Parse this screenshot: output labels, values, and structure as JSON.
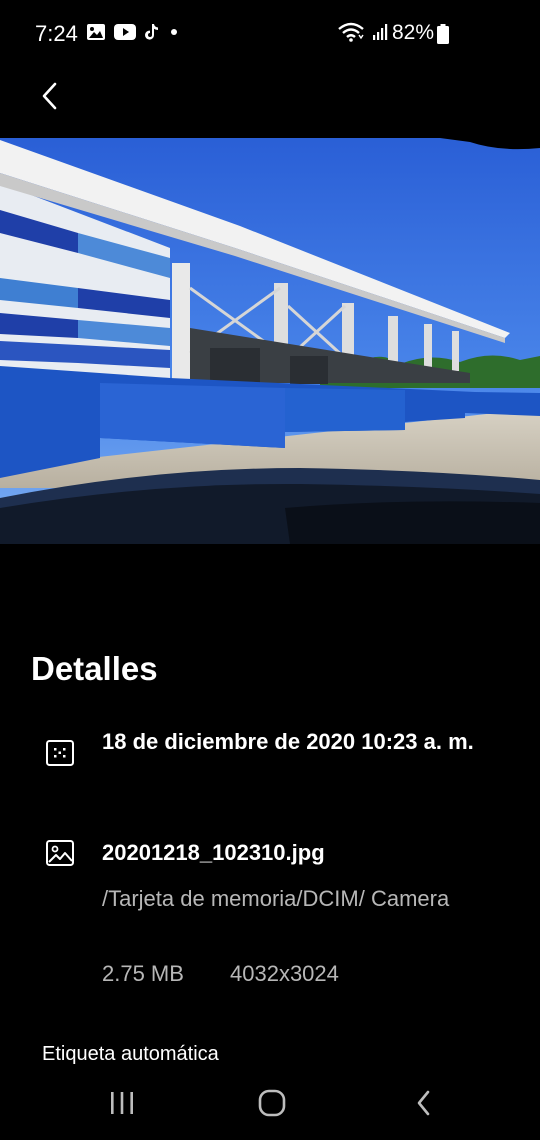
{
  "status_bar": {
    "time": "7:24",
    "battery": "82%",
    "left_icons": [
      "gallery-icon",
      "youtube-icon",
      "tiktok-icon",
      "dot-icon"
    ],
    "right_icons": [
      "wifi-icon",
      "signal-icon",
      "battery-icon"
    ]
  },
  "toolbar": {
    "back_icon": "chevron-left-icon"
  },
  "details": {
    "title": "Detalles",
    "date": "18 de diciembre de 2020 10:23 a. m.",
    "file_name": "20201218_102310.jpg",
    "path": "/Tarjeta de memoria/DCIM/ Camera",
    "size": "2.75 MB",
    "resolution": "4032x3024",
    "auto_tag_label": "Etiqueta automática"
  },
  "nav_bar": {
    "icons": [
      "recent-apps-icon",
      "home-icon",
      "back-icon"
    ]
  }
}
